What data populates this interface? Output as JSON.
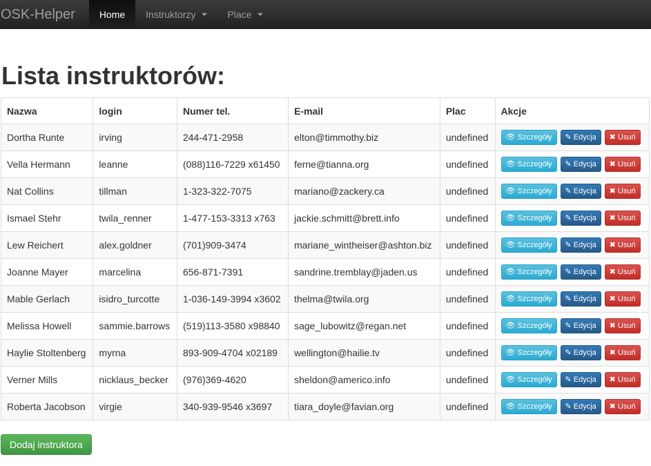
{
  "navbar": {
    "brand": "OSK-Helper",
    "items": [
      {
        "label": "Home",
        "active": true,
        "dropdown": false
      },
      {
        "label": "Instruktorzy",
        "active": false,
        "dropdown": true
      },
      {
        "label": "Place",
        "active": false,
        "dropdown": true
      }
    ]
  },
  "page_title": "Lista instruktorów:",
  "table": {
    "headers": [
      "Nazwa",
      "login",
      "Numer tel.",
      "E-mail",
      "Plac",
      "Akcje"
    ],
    "rows": [
      [
        "Dortha Runte",
        "irving",
        "244-471-2958",
        "elton@timmothy.biz",
        "undefined"
      ],
      [
        "Vella Hermann",
        "leanne",
        "(088)116-7229 x61450",
        "ferne@tianna.org",
        "undefined"
      ],
      [
        "Nat Collins",
        "tillman",
        "1-323-322-7075",
        "mariano@zackery.ca",
        "undefined"
      ],
      [
        "Ismael Stehr",
        "twila_renner",
        "1-477-153-3313 x763",
        "jackie.schmitt@brett.info",
        "undefined"
      ],
      [
        "Lew Reichert",
        "alex.goldner",
        "(701)909-3474",
        "mariane_wintheiser@ashton.biz",
        "undefined"
      ],
      [
        "Joanne Mayer",
        "marcelina",
        "656-871-7391",
        "sandrine.tremblay@jaden.us",
        "undefined"
      ],
      [
        "Mable Gerlach",
        "isidro_turcotte",
        "1-036-149-3994 x3602",
        "thelma@twila.org",
        "undefined"
      ],
      [
        "Melissa Howell",
        "sammie.barrows",
        "(519)113-3580 x98840",
        "sage_lubowitz@regan.net",
        "undefined"
      ],
      [
        "Haylie Stoltenberg",
        "myrna",
        "893-909-4704 x02189",
        "wellington@hailie.tv",
        "undefined"
      ],
      [
        "Verner Mills",
        "nicklaus_becker",
        "(976)369-4620",
        "sheldon@americo.info",
        "undefined"
      ],
      [
        "Roberta Jacobson",
        "virgie",
        "340-939-9546 x3697",
        "tiara_doyle@favian.org",
        "undefined"
      ]
    ],
    "actions": {
      "details": {
        "label": "Szczegóły",
        "icon": "eye-icon",
        "color": "#5bc0de"
      },
      "edit": {
        "label": "Edycja",
        "icon": "edit-icon",
        "color": "#337ab7"
      },
      "delete": {
        "label": "Usuń",
        "icon": "close-icon",
        "color": "#d9534f"
      }
    }
  },
  "add_button": {
    "label": "Dodaj instruktora",
    "color": "#5cb85c"
  }
}
